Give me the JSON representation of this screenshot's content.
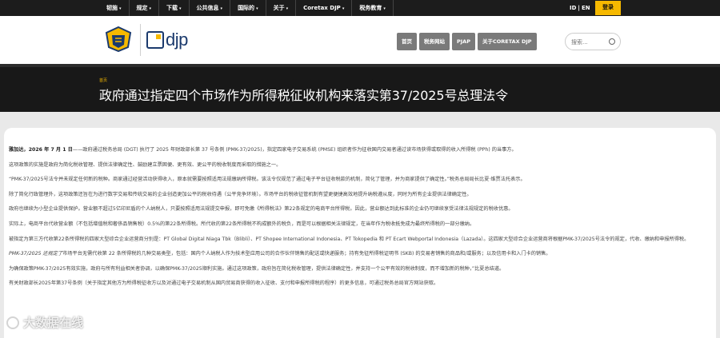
{
  "topnav": {
    "items": [
      {
        "label": "韧施",
        "caret": "▾"
      },
      {
        "label": "规定",
        "caret": "▾"
      },
      {
        "label": "下载",
        "caret": "▾"
      },
      {
        "label": "公共信息",
        "caret": "▾"
      },
      {
        "label": "国际的",
        "caret": "▾"
      },
      {
        "label": "关于",
        "caret": "▾"
      },
      {
        "label": "Coretax DJP",
        "caret": "▾"
      },
      {
        "label": "税务教育",
        "caret": "▾"
      }
    ],
    "lang_id": "ID",
    "lang_sep": "|",
    "lang_en": "EN",
    "login_label": "登录"
  },
  "header": {
    "logo_text": "djp",
    "menu": [
      "首页",
      "税务网站",
      "PJAP",
      "关于CORETAX DJP"
    ],
    "search_placeholder": "搜索..."
  },
  "hero": {
    "breadcrumb": "首页",
    "title": "政府通过指定四个市场作为所得税征收机构来落实第37/2025号总理法令"
  },
  "article": {
    "p1_lead": "雅加达，2026 年 7 月 1 日",
    "p1": "——政府通过税务总局 (DGT) 执行了 2025 年财政部长第 37 号条例 (PMK-37/2025)，指定四家电子交易系统 (PMSE) 组织者作为征收国内交易者通过读市场获得或取得的收入所得税 (PPh) 的当事方。",
    "p2": "这项政策的实施是政府为简化税收管理、提供法律确定性、鼓励建立票固便、更有效、更公平的税收制度而采取的措施之一。",
    "p3": "“PMK-37/2025号法令并未规定任何新的税种。商家通过经营活动获得收入，原本就需要按照适用法规缴纳所得税。该法令仅规范了通过电子平台征收税款的机制，简化了管理，并为商家提供了确定性。”税务总局局长比夏·维贾法托表示。",
    "p4": "除了简化行政管理外，这项政策还旨在为进行数字交易和传统交易的企业创造更加公平的税收待遇（公平竞争环境）。市场平台的税收征管机制有望更便捷高效地提升纳税遵从度，同时为所有企业提供法律确定性。",
    "p5": "政府也继续为小型企业提供保护。营业额不超过5亿印尼盾的个人纳税人，只要按照适用法规提交申报，即可免缴《所得税法》第22条规定的电商平台所得税。因此，营业额达到此标准的企业仍可继续享受法律法规规定的税收优惠。",
    "p6": "实际上，电商平台代收营业额（不包括增值税和奢侈品销售税）0.5%的第22条所得税。所代收的第22条所得税不构成额外的税负，而是可以根据相关法律规定，在当年作为税收抵免成为最终所得税的一部分缴纳。",
    "p7": "被指定为第三方代收第22条所得税的四家大型综合企业运营商分别是：PT Global Digital Niaga Tbk（Blibli）、PT Shopee International Indonesia、PT Tokopedia 和 PT Ecart Webportal Indonesia（Lazada）。这四家大型综合企业运营商将根据PMK-37/2025号法令的规定，代收、缴纳和申报所得税。",
    "p8_lead": "PMK-37/2025 还规定了",
    "p8": "市场平台无需代收第 22 条所得税的几种交易类型，包括：国内个人纳税人作为技术型应用公司的合作伙伴销售的配送或快递服务；持有免征所得税证明书 (SKB) 的交易者销售的商品和/或服务；以及信用卡和入门卡的销售。",
    "p9": "为确保政策PMK-37/2025有效实施，政府与所有利益相关者协调，以确保PMK-37/2025顺利实施。通过这项政策，政府旨在简化税收管理，提供法律确定性，并支持一个公平有效的税收制度，而不增加新的税种，”比夏总结道。",
    "p10": "有关财政部长2025年第37号条例（关于指定其他方为所得税征收方以及对通过电子交易机制从国内贸易商获得的收入征收、支付和申报所得税的程序）的更多信息，可通过税务总局官方网站获取。"
  },
  "watermark": {
    "text": "大数据在线"
  }
}
